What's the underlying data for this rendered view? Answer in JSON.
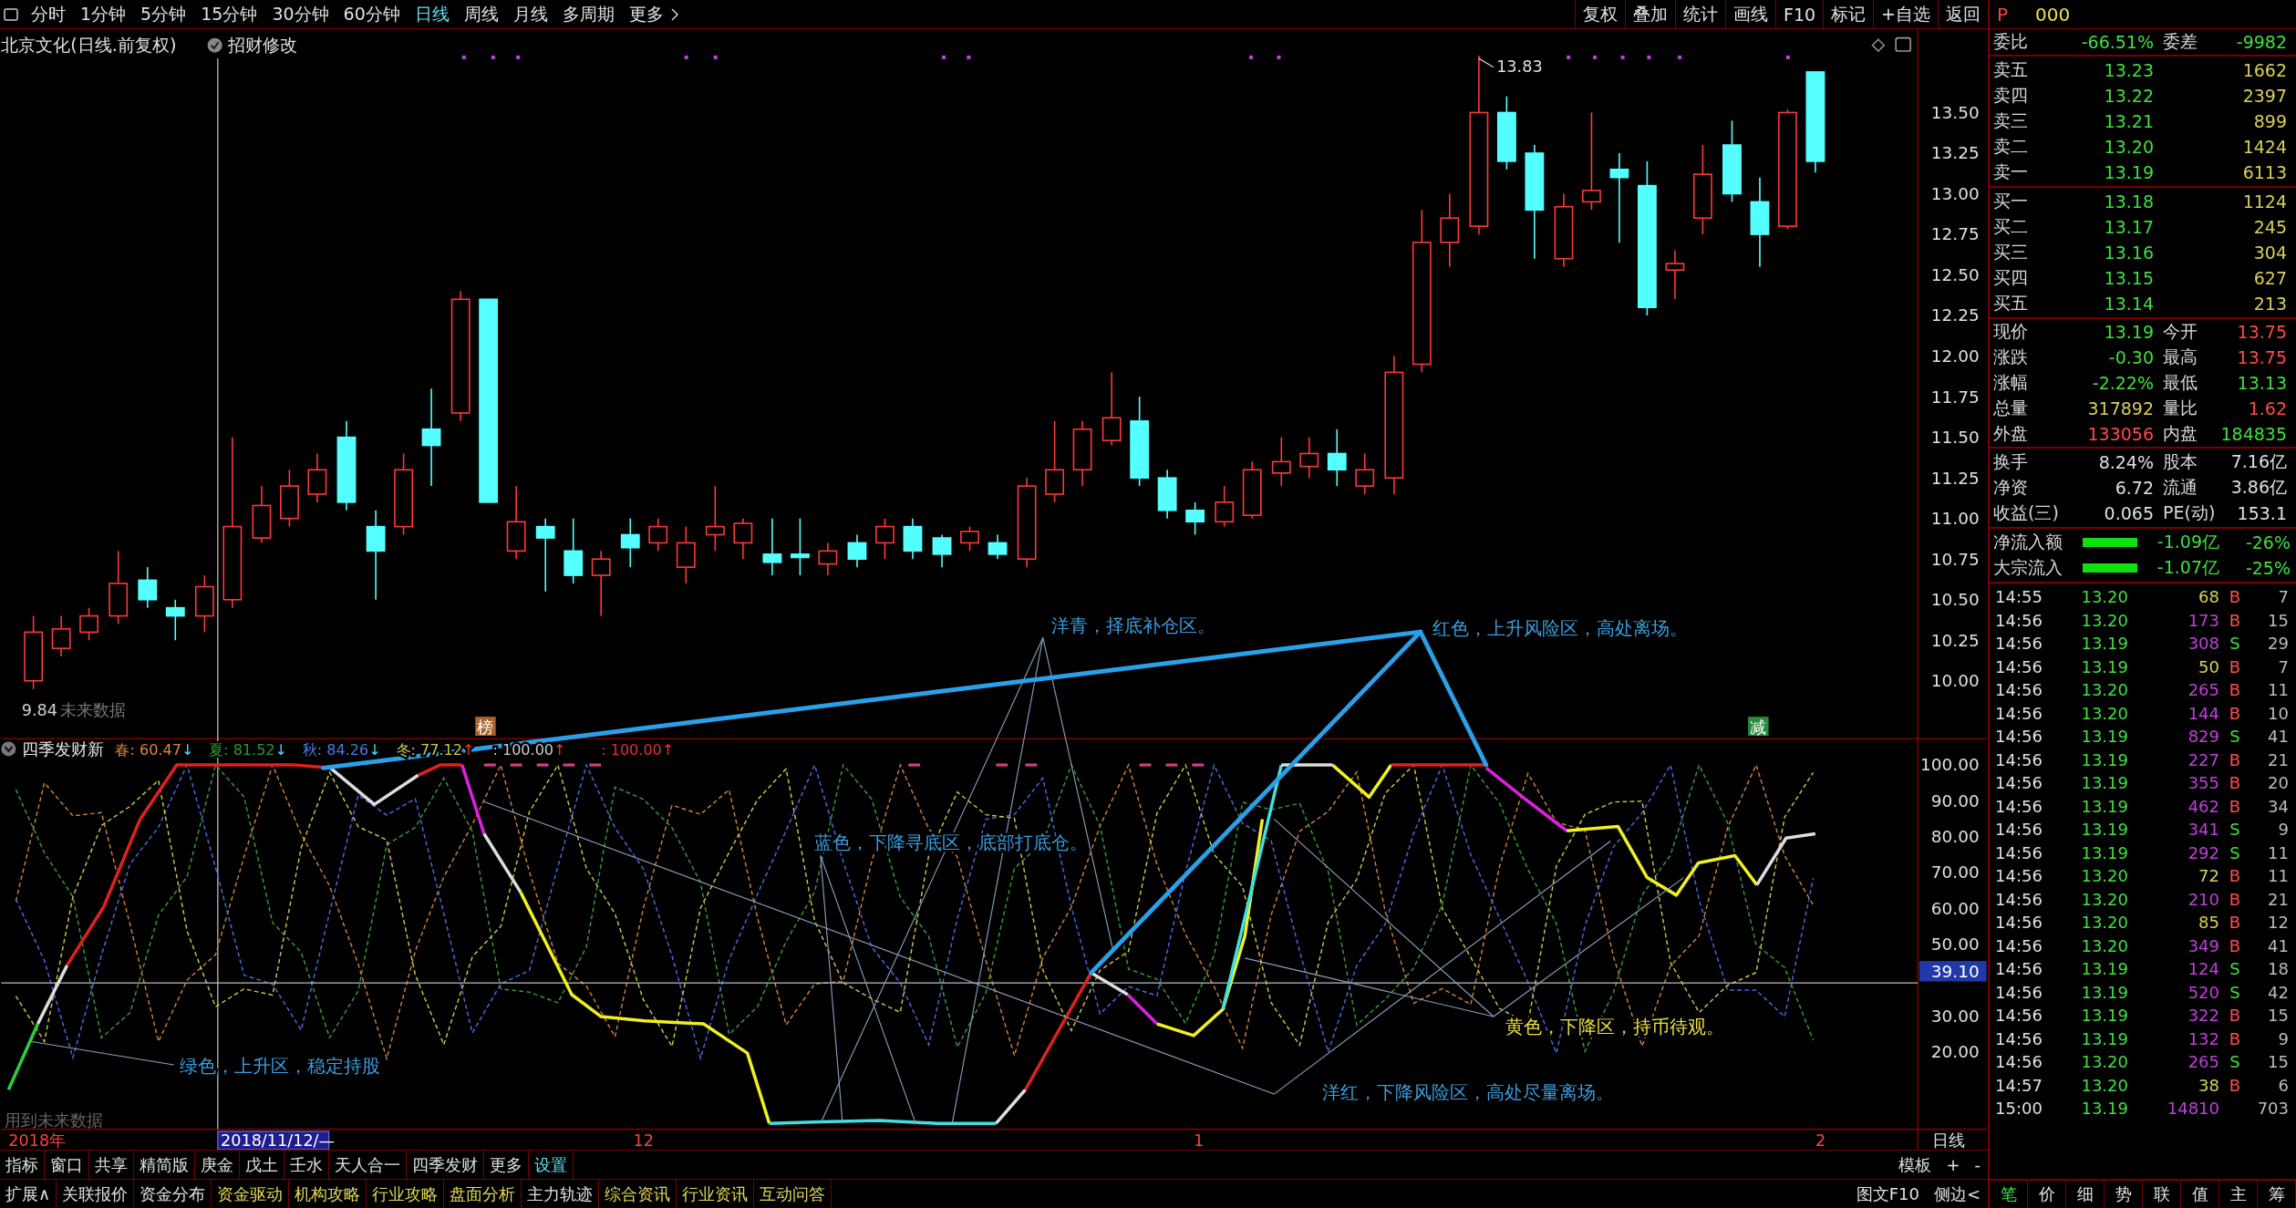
{
  "toolbar": {
    "periods": [
      {
        "label": "分时",
        "selected": false
      },
      {
        "label": "1分钟",
        "selected": false
      },
      {
        "label": "5分钟",
        "selected": false
      },
      {
        "label": "15分钟",
        "selected": false
      },
      {
        "label": "30分钟",
        "selected": false
      },
      {
        "label": "60分钟",
        "selected": false
      },
      {
        "label": "日线",
        "selected": true
      },
      {
        "label": "周线",
        "selected": false
      },
      {
        "label": "月线",
        "selected": false
      },
      {
        "label": "多周期",
        "selected": false
      }
    ],
    "more": "更多",
    "actions": [
      "复权",
      "叠加",
      "统计",
      "画线",
      "F10",
      "标记",
      "+自选",
      "返回"
    ]
  },
  "quote_header": {
    "market": "P",
    "code": "000"
  },
  "chart": {
    "title": "北京文化(日线.前复权)",
    "formula": "招财修改",
    "high_label": "13.83",
    "low_label": "9.84",
    "low_note": "未来数据",
    "price_axis": [
      "13.50",
      "13.25",
      "13.00",
      "12.75",
      "12.50",
      "12.25",
      "12.00",
      "11.75",
      "11.50",
      "11.25",
      "11.00",
      "10.75",
      "10.50",
      "10.25",
      "10.00"
    ],
    "badges": [
      {
        "text": "榜",
        "kind": "buy"
      },
      {
        "text": "减",
        "kind": "sell"
      }
    ]
  },
  "indicator": {
    "name": "四季发财新",
    "legend": [
      {
        "text": "春: 60.47",
        "rising": false,
        "arrow": "↓",
        "color": "#e0843c"
      },
      {
        "text": "夏: 81.52",
        "rising": false,
        "arrow": "↓",
        "color": "#2e9a2e"
      },
      {
        "text": "秋: 84.26",
        "rising": false,
        "arrow": "↓",
        "color": "#4a7ce8"
      },
      {
        "text": "冬: 77.12",
        "rising": true,
        "arrow": "↑",
        "color": "#c8c840"
      },
      {
        "text": ": 100.00",
        "rising": true,
        "arrow": "↑",
        "color": "#c8c8c8"
      },
      {
        "text": ": 100.00",
        "rising": true,
        "arrow": "↑",
        "color": "#e03030"
      }
    ],
    "axis": [
      "100.00",
      "90.00",
      "80.00",
      "70.00",
      "60.00",
      "50.00",
      "30.00",
      "20.00"
    ],
    "cursor_value": "39.10",
    "note": "用到未来数据",
    "annotations": [
      {
        "text": "洋青，择底补仓区。",
        "color": "#3a9ee0"
      },
      {
        "text": "红色，上升风险区，高处离场。",
        "color": "#3a9ee0"
      },
      {
        "text": "蓝色，下降寻底区，底部打底仓。",
        "color": "#3a9ee0"
      },
      {
        "text": "绿色，上升区，稳定持股",
        "color": "#3a9ee0"
      },
      {
        "text": "黄色，下降区，持币待观。",
        "color": "#e8e040"
      },
      {
        "text": "洋红，下降风险区，高处尽量离场。",
        "color": "#3a9ee0"
      }
    ]
  },
  "date_axis": {
    "labels": [
      {
        "text": "2018年",
        "kind": "year"
      },
      {
        "text": "2018/11/12/—",
        "kind": "cursor"
      },
      {
        "text": "12",
        "kind": "month"
      },
      {
        "text": "1",
        "kind": "month"
      },
      {
        "text": "2",
        "kind": "month"
      }
    ],
    "period": "日线"
  },
  "bottom_tabs": [
    {
      "label": "指标",
      "selected": false
    },
    {
      "label": "窗口",
      "selected": false
    },
    {
      "label": "共享",
      "selected": false
    },
    {
      "label": "精简版",
      "selected": false
    },
    {
      "label": "庚金",
      "selected": false
    },
    {
      "label": "戊土",
      "selected": false
    },
    {
      "label": "壬水",
      "selected": false
    },
    {
      "label": "天人合一",
      "selected": false
    },
    {
      "label": "四季发财",
      "selected": false
    },
    {
      "label": "更多",
      "selected": false
    },
    {
      "label": "设置",
      "selected": true
    }
  ],
  "bottom_tools": [
    "模板",
    "+",
    "-"
  ],
  "extension_tabs": [
    {
      "label": "扩展∧",
      "highlight": false
    },
    {
      "label": "关联报价",
      "highlight": false
    },
    {
      "label": "资金分布",
      "highlight": false
    },
    {
      "label": "资金驱动",
      "highlight": true
    },
    {
      "label": "机构攻略",
      "highlight": true
    },
    {
      "label": "行业攻略",
      "highlight": true
    },
    {
      "label": "盘面分析",
      "highlight": true
    },
    {
      "label": "主力轨迹",
      "highlight": false
    },
    {
      "label": "综合资讯",
      "highlight": true
    },
    {
      "label": "行业资讯",
      "highlight": true
    },
    {
      "label": "互动问答",
      "highlight": true
    }
  ],
  "extension_links": [
    "图文F10",
    "侧边<"
  ],
  "order_book": {
    "ratio": {
      "label": "委比",
      "value": "-66.51%",
      "label2": "委差",
      "value2": "-9982"
    },
    "asks": [
      {
        "label": "卖五",
        "price": "13.23",
        "volume": "1662"
      },
      {
        "label": "卖四",
        "price": "13.22",
        "volume": "2397"
      },
      {
        "label": "卖三",
        "price": "13.21",
        "volume": "899"
      },
      {
        "label": "卖二",
        "price": "13.20",
        "volume": "1424"
      },
      {
        "label": "卖一",
        "price": "13.19",
        "volume": "6113"
      }
    ],
    "bids": [
      {
        "label": "买一",
        "price": "13.18",
        "volume": "1124"
      },
      {
        "label": "买二",
        "price": "13.17",
        "volume": "245"
      },
      {
        "label": "买三",
        "price": "13.16",
        "volume": "304"
      },
      {
        "label": "买四",
        "price": "13.15",
        "volume": "627"
      },
      {
        "label": "买五",
        "price": "13.14",
        "volume": "213"
      }
    ]
  },
  "stats": [
    {
      "label": "现价",
      "value": "13.19",
      "color": "#3fe03f"
    },
    {
      "label": "今开",
      "value": "13.75",
      "color": "#ff4a4a"
    },
    {
      "label": "涨跌",
      "value": "-0.30",
      "color": "#3fe03f"
    },
    {
      "label": "最高",
      "value": "13.75",
      "color": "#ff4a4a"
    },
    {
      "label": "涨幅",
      "value": "-2.22%",
      "color": "#3fe03f"
    },
    {
      "label": "最低",
      "value": "13.13",
      "color": "#3fe03f"
    },
    {
      "label": "总量",
      "value": "317892",
      "color": "#d8cf5a"
    },
    {
      "label": "量比",
      "value": "1.62",
      "color": "#ff4a4a"
    },
    {
      "label": "外盘",
      "value": "133056",
      "color": "#ff4a4a"
    },
    {
      "label": "内盘",
      "value": "184835",
      "color": "#3fe03f"
    }
  ],
  "fundamentals": [
    {
      "label": "换手",
      "value": "8.24%",
      "label2": "股本",
      "value2": "7.16亿"
    },
    {
      "label": "净资",
      "value": "6.72",
      "label2": "流通",
      "value2": "3.86亿"
    },
    {
      "label": "收益(三)",
      "value": "0.065",
      "label2": "PE(动)",
      "value2": "153.1"
    }
  ],
  "flows": [
    {
      "label": "净流入额",
      "amount": "-1.09亿",
      "percent": "-26%"
    },
    {
      "label": "大宗流入",
      "amount": "-1.07亿",
      "percent": "-25%"
    }
  ],
  "trades": [
    {
      "time": "14:55",
      "price": "13.20",
      "volume": "68",
      "big": false,
      "side": "B",
      "kind": "buy",
      "count": "7"
    },
    {
      "time": "14:56",
      "price": "13.20",
      "volume": "173",
      "big": true,
      "side": "B",
      "kind": "buy",
      "count": "15"
    },
    {
      "time": "14:56",
      "price": "13.19",
      "volume": "308",
      "big": true,
      "side": "S",
      "kind": "sell",
      "count": "29"
    },
    {
      "time": "14:56",
      "price": "13.19",
      "volume": "50",
      "big": false,
      "side": "B",
      "kind": "buy",
      "count": "7"
    },
    {
      "time": "14:56",
      "price": "13.20",
      "volume": "265",
      "big": true,
      "side": "B",
      "kind": "buy",
      "count": "11"
    },
    {
      "time": "14:56",
      "price": "13.20",
      "volume": "144",
      "big": true,
      "side": "B",
      "kind": "buy",
      "count": "10"
    },
    {
      "time": "14:56",
      "price": "13.19",
      "volume": "829",
      "big": true,
      "side": "S",
      "kind": "sell",
      "count": "41"
    },
    {
      "time": "14:56",
      "price": "13.19",
      "volume": "227",
      "big": true,
      "side": "B",
      "kind": "buy",
      "count": "21"
    },
    {
      "time": "14:56",
      "price": "13.19",
      "volume": "355",
      "big": true,
      "side": "B",
      "kind": "buy",
      "count": "20"
    },
    {
      "time": "14:56",
      "price": "13.19",
      "volume": "462",
      "big": true,
      "side": "B",
      "kind": "buy",
      "count": "34"
    },
    {
      "time": "14:56",
      "price": "13.19",
      "volume": "341",
      "big": true,
      "side": "S",
      "kind": "sell",
      "count": "9"
    },
    {
      "time": "14:56",
      "price": "13.19",
      "volume": "292",
      "big": true,
      "side": "S",
      "kind": "sell",
      "count": "11"
    },
    {
      "time": "14:56",
      "price": "13.20",
      "volume": "72",
      "big": false,
      "side": "B",
      "kind": "buy",
      "count": "11"
    },
    {
      "time": "14:56",
      "price": "13.20",
      "volume": "210",
      "big": true,
      "side": "B",
      "kind": "buy",
      "count": "21"
    },
    {
      "time": "14:56",
      "price": "13.20",
      "volume": "85",
      "big": false,
      "side": "B",
      "kind": "buy",
      "count": "12"
    },
    {
      "time": "14:56",
      "price": "13.20",
      "volume": "349",
      "big": true,
      "side": "B",
      "kind": "buy",
      "count": "41"
    },
    {
      "time": "14:56",
      "price": "13.19",
      "volume": "124",
      "big": true,
      "side": "S",
      "kind": "sell",
      "count": "18"
    },
    {
      "time": "14:56",
      "price": "13.19",
      "volume": "520",
      "big": true,
      "side": "S",
      "kind": "sell",
      "count": "42"
    },
    {
      "time": "14:56",
      "price": "13.19",
      "volume": "322",
      "big": true,
      "side": "B",
      "kind": "buy",
      "count": "15"
    },
    {
      "time": "14:56",
      "price": "13.19",
      "volume": "132",
      "big": true,
      "side": "B",
      "kind": "buy",
      "count": "9"
    },
    {
      "time": "14:56",
      "price": "13.20",
      "volume": "265",
      "big": true,
      "side": "S",
      "kind": "sell",
      "count": "15"
    },
    {
      "time": "14:57",
      "price": "13.20",
      "volume": "38",
      "big": false,
      "side": "B",
      "kind": "buy",
      "count": "6"
    },
    {
      "time": "15:00",
      "price": "13.19",
      "volume": "14810",
      "big": true,
      "count": "703"
    }
  ],
  "panel_tabs": [
    {
      "label": "笔",
      "selected": true
    },
    {
      "label": "价",
      "selected": false
    },
    {
      "label": "细",
      "selected": false
    },
    {
      "label": "势",
      "selected": false
    },
    {
      "label": "联",
      "selected": false
    },
    {
      "label": "值",
      "selected": false
    },
    {
      "label": "主",
      "selected": false
    },
    {
      "label": "筹",
      "selected": false
    }
  ]
}
